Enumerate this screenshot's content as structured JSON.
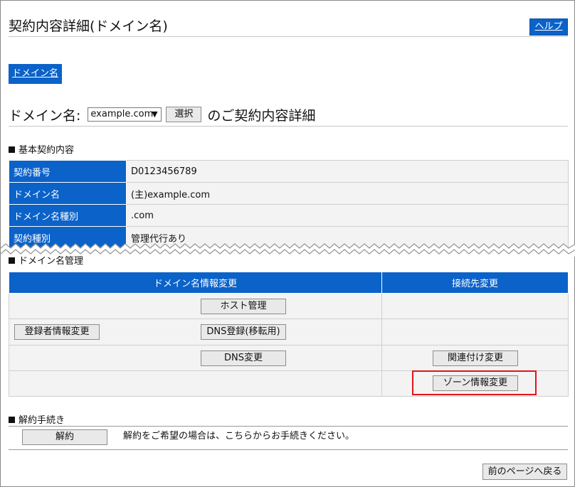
{
  "header": {
    "title": "契約内容詳細(ドメイン名)",
    "help_label": "ヘルプ"
  },
  "tab": {
    "label": "ドメイン名"
  },
  "domain_select": {
    "label": "ドメイン名:",
    "selected": "example.com",
    "select_button": "選択",
    "suffix": "のご契約内容詳細"
  },
  "basic": {
    "heading": "基本契約内容",
    "rows": [
      {
        "key": "契約番号",
        "value": "D0123456789"
      },
      {
        "key": "ドメイン名",
        "value": "(主)example.com"
      },
      {
        "key": "ドメイン名種別",
        "value": ".com"
      },
      {
        "key": "契約種別",
        "value": "管理代行あり"
      }
    ]
  },
  "management": {
    "heading": "ドメイン名管理",
    "col_left": "ドメイン名情報変更",
    "col_right": "接続先変更",
    "buttons": {
      "host": "ホスト管理",
      "registrant": "登録者情報変更",
      "dns_register": "DNS登録(移転用)",
      "dns_change": "DNS変更",
      "link_change": "関連付け変更",
      "zone_change": "ゾーン情報変更"
    }
  },
  "cancellation": {
    "heading": "解約手続き",
    "button": "解約",
    "text": "解約をご希望の場合は、こちらからお手続きください。"
  },
  "footer": {
    "back_button": "前のページへ戻る"
  },
  "colors": {
    "accent": "#0b62c9",
    "highlight": "#e4141a"
  }
}
